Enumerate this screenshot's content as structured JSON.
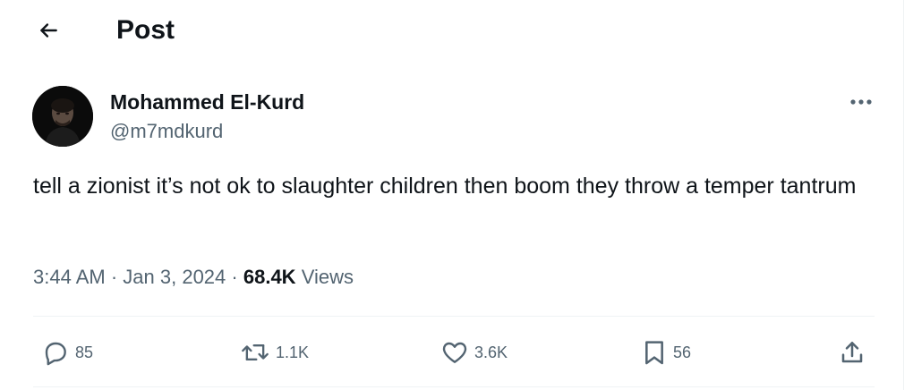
{
  "header": {
    "back_icon": "arrow-left-icon",
    "title": "Post"
  },
  "author": {
    "name": "Mohammed El-Kurd",
    "handle": "@m7mdkurd",
    "avatar_icon": "avatar-photo",
    "more_icon": "more-horizontal-icon"
  },
  "tweet": {
    "text": "tell a zionist it’s not ok to slaughter children then boom they throw a temper tantrum"
  },
  "meta": {
    "time": "3:44 AM",
    "separator": "·",
    "date": "Jan 3, 2024",
    "views_count": "68.4K",
    "views_label": "Views"
  },
  "actions": {
    "replies": "85",
    "reposts": "1.1K",
    "likes": "3.6K",
    "bookmarks": "56",
    "reply_icon": "reply-icon",
    "repost_icon": "repost-icon",
    "like_icon": "heart-icon",
    "bookmark_icon": "bookmark-icon",
    "share_icon": "share-icon"
  },
  "colors": {
    "text": "#0f1419",
    "secondary": "#536471",
    "border": "#eff3f4"
  }
}
